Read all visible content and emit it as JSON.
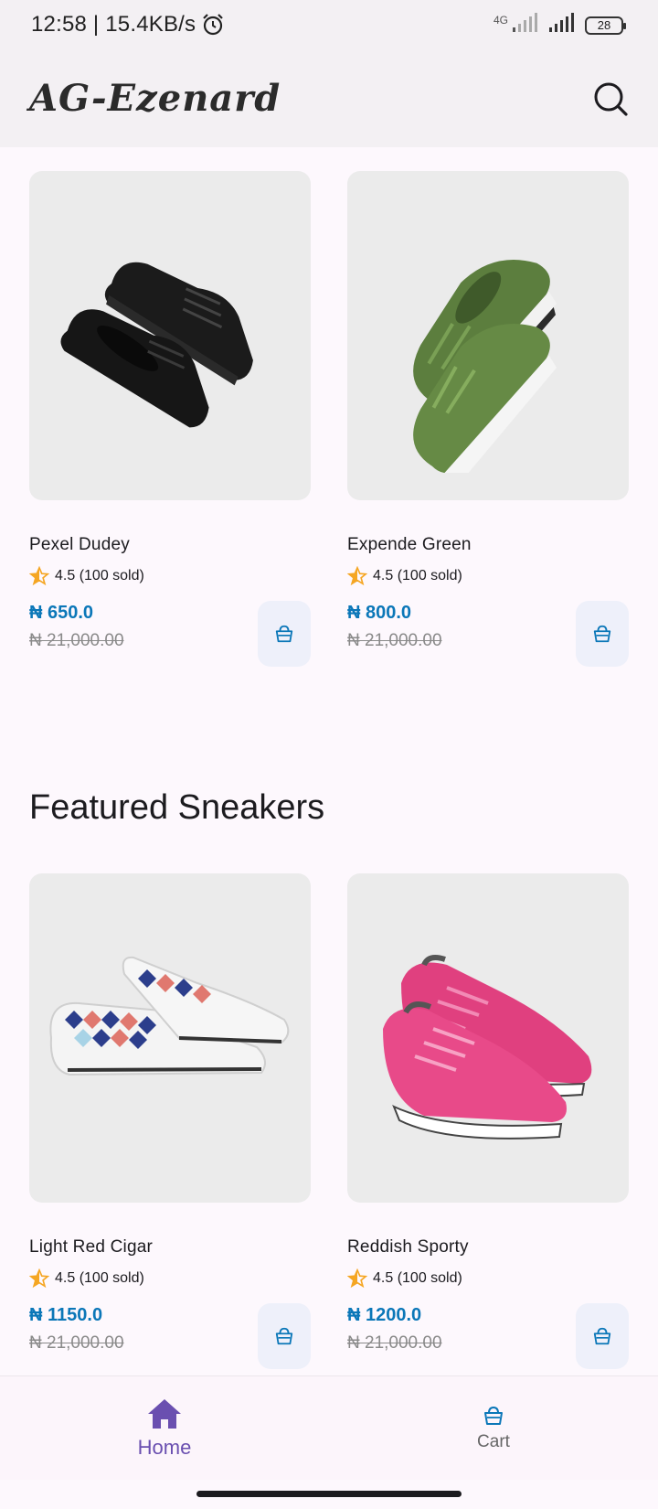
{
  "status_bar": {
    "time": "12:58 | 15.4KB/s",
    "network": "4G",
    "battery": "28",
    "icons": [
      "alarm-icon",
      "signal-icon",
      "signal-icon",
      "battery-icon"
    ]
  },
  "app_bar": {
    "title": "AG-Ezenard",
    "search_icon": "search-icon"
  },
  "products_top": [
    {
      "name": "Pexel Dudey",
      "rating": "4.5 (100 sold)",
      "price": "₦ 650.0",
      "old_price": "₦ 21,000.00",
      "image": "black-sneaker"
    },
    {
      "name": "Expende Green",
      "rating": "4.5 (100 sold)",
      "price": "₦ 800.0",
      "old_price": "₦ 21,000.00",
      "image": "green-sneaker"
    }
  ],
  "featured": {
    "title": "Featured Sneakers",
    "products": [
      {
        "name": "Light Red Cigar",
        "rating": "4.5 (100 sold)",
        "price": "₦ 1150.0",
        "old_price": "₦ 21,000.00",
        "image": "argyle-sneaker"
      },
      {
        "name": "Reddish Sporty",
        "rating": "4.5 (100 sold)",
        "price": "₦ 1200.0",
        "old_price": "₦ 21,000.00",
        "image": "pink-sneaker"
      }
    ]
  },
  "bottom_nav": {
    "items": [
      {
        "label": "Home",
        "icon": "home-icon",
        "active": true
      },
      {
        "label": "Cart",
        "icon": "cart-icon",
        "active": false
      }
    ]
  },
  "colors": {
    "accent": "#6a4fb0",
    "price": "#0b77b8",
    "star": "#f5a623"
  }
}
